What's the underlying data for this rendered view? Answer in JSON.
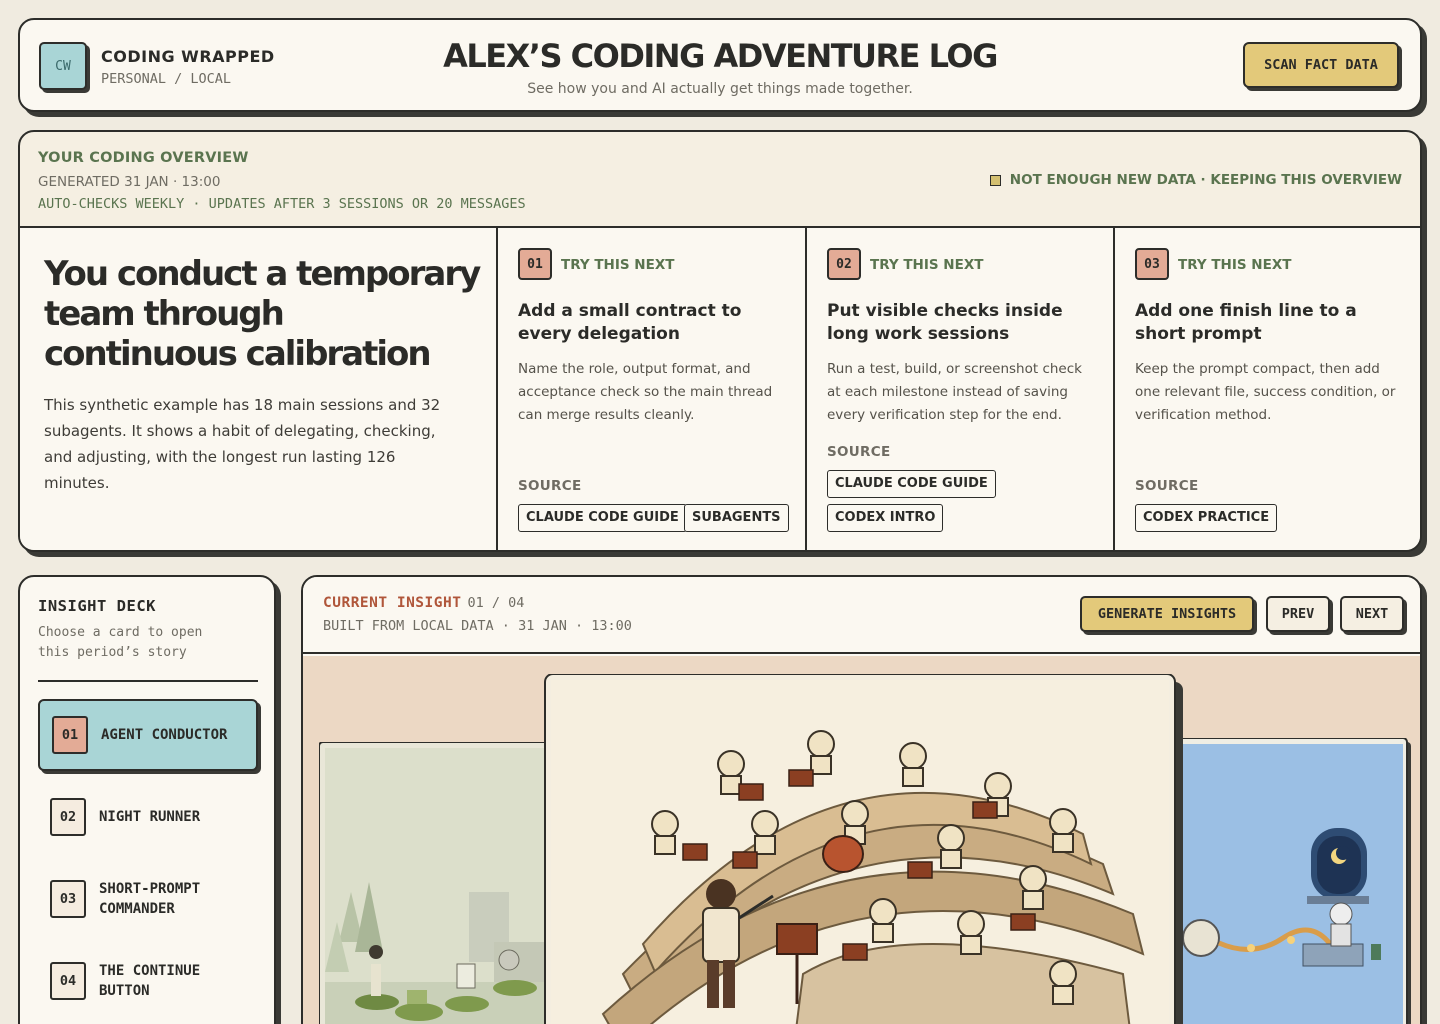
{
  "header": {
    "logo": "CW",
    "brand_title": "CODING WRAPPED",
    "brand_sub": "PERSONAL / LOCAL",
    "title": "ALEX’S CODING ADVENTURE LOG",
    "subtitle": "See how you and AI actually get things made together.",
    "scan_button": "SCAN FACT DATA"
  },
  "overview": {
    "kicker": "YOUR CODING OVERVIEW",
    "generated": "GENERATED 31 JAN · 13:00",
    "auto_checks": "AUTO-CHECKS WEEKLY · UPDATES AFTER 3 SESSIONS OR 20 MESSAGES",
    "status": "NOT ENOUGH NEW DATA · KEEPING THIS OVERVIEW",
    "headline": "You conduct a temporary team through continuous calibration",
    "summary": "This synthetic example has 18 main sessions and 32 subagents. It shows a habit of delegating, checking, and adjusting, with the longest run lasting 126 minutes.",
    "tips": [
      {
        "num": "01",
        "kicker": "TRY THIS NEXT",
        "title": "Add a small contract to every delegation",
        "body": "Name the role, output format, and acceptance check so the main thread can merge results cleanly.",
        "source_label": "SOURCE",
        "sources": [
          "CLAUDE CODE GUIDE",
          "SUBAGENTS"
        ]
      },
      {
        "num": "02",
        "kicker": "TRY THIS NEXT",
        "title": "Put visible checks inside long work sessions",
        "body": "Run a test, build, or screenshot check at each milestone instead of saving every verification step for the end.",
        "source_label": "SOURCE",
        "sources": [
          "CLAUDE CODE GUIDE",
          "CODEX INTRO"
        ]
      },
      {
        "num": "03",
        "kicker": "TRY THIS NEXT",
        "title": "Add one finish line to a short prompt",
        "body": "Keep the prompt compact, then add one relevant file, success condition, or verification method.",
        "source_label": "SOURCE",
        "sources": [
          "CODEX PRACTICE"
        ]
      }
    ]
  },
  "deck": {
    "title": "INSIGHT DECK",
    "subtitle": "Choose a card to open this period’s story",
    "items": [
      {
        "num": "01",
        "label": "AGENT CONDUCTOR"
      },
      {
        "num": "02",
        "label": "NIGHT RUNNER"
      },
      {
        "num": "03",
        "label": "SHORT-PROMPT COMMANDER"
      },
      {
        "num": "04",
        "label": "THE CONTINUE BUTTON"
      }
    ]
  },
  "current": {
    "kicker": "CURRENT INSIGHT",
    "counter": "01 / 04",
    "built": "BUILT FROM LOCAL DATA · 31 JAN · 13:00",
    "generate_button": "GENERATE INSIGHTS",
    "prev_button": "PREV",
    "next_button": "NEXT"
  },
  "colors": {
    "page_bg": "#f0ebe0",
    "panel_bg": "#fbf8f1",
    "accent_teal": "#a9d5d6",
    "accent_gold": "#e3c97a",
    "accent_salmon": "#e3ab96",
    "kicker_green": "#5a744f",
    "insight_red": "#b0563a"
  }
}
